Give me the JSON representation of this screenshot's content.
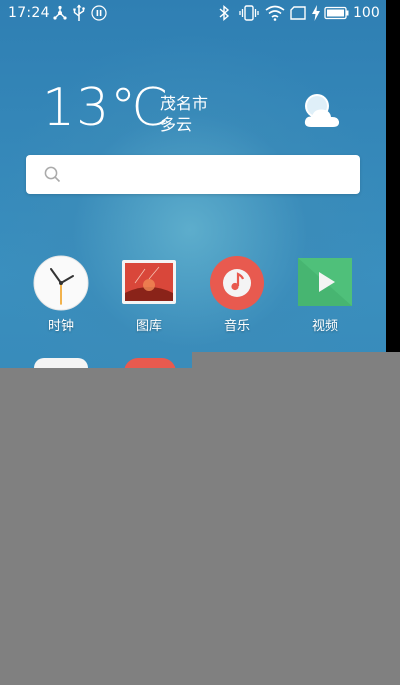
{
  "status_bar": {
    "time": "17:24",
    "battery": "100",
    "icons": [
      "usb-tether-icon",
      "usb-icon",
      "pause-icon",
      "bluetooth-icon",
      "vibrate-icon",
      "wifi-icon",
      "sim-card-icon",
      "charging-bolt-icon",
      "battery-icon"
    ]
  },
  "weather": {
    "temperature": "13℃",
    "city": "茂名市",
    "condition": "多云",
    "icon": "cloudy-icon"
  },
  "search": {
    "placeholder": "",
    "value": ""
  },
  "apps": [
    {
      "label": "时钟",
      "icon": "clock-icon"
    },
    {
      "label": "图库",
      "icon": "gallery-icon"
    },
    {
      "label": "音乐",
      "icon": "music-icon"
    },
    {
      "label": "视频",
      "icon": "video-icon"
    }
  ],
  "colors": {
    "wallpaper": "#3a8fbe",
    "overlay": "#808080",
    "music": "#e85a4f",
    "video": "#4fc07a"
  }
}
